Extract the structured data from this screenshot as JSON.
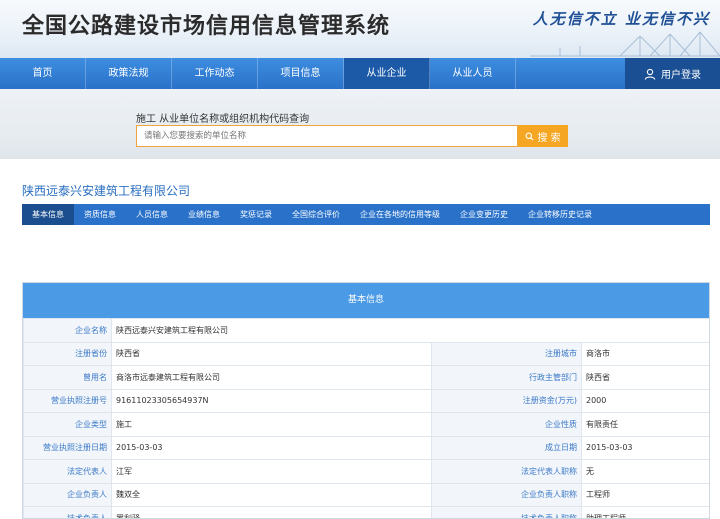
{
  "banner": {
    "title": "全国公路建设市场信用信息管理系统",
    "slogan": "人无信不立 业无信不兴"
  },
  "nav": {
    "items": [
      {
        "label": "首页"
      },
      {
        "label": "政策法规"
      },
      {
        "label": "工作动态"
      },
      {
        "label": "项目信息"
      },
      {
        "label": "从业企业"
      },
      {
        "label": "从业人员"
      }
    ],
    "active_index": 4,
    "login_label": "用户登录"
  },
  "search": {
    "label": "施工 从业单位名称或组织机构代码查询",
    "placeholder": "请输入您要搜索的单位名称",
    "button_label": "搜 索"
  },
  "company": {
    "name": "陕西远泰兴安建筑工程有限公司"
  },
  "tabs": [
    {
      "label": "基本信息"
    },
    {
      "label": "资质信息"
    },
    {
      "label": "人员信息"
    },
    {
      "label": "业绩信息"
    },
    {
      "label": "奖惩记录"
    },
    {
      "label": "全国综合评价"
    },
    {
      "label": "企业在各地的信用等级"
    },
    {
      "label": "企业变更历史"
    },
    {
      "label": "企业转移历史记录"
    }
  ],
  "info": {
    "header": "基本信息",
    "company_name_label": "企业名称",
    "company_name_value": "陕西远泰兴安建筑工程有限公司",
    "rows": [
      {
        "l1": "注册省份",
        "v1": "陕西省",
        "l2": "注册城市",
        "v2": "商洛市"
      },
      {
        "l1": "曾用名",
        "v1": "商洛市远泰建筑工程有限公司",
        "l2": "行政主管部门",
        "v2": "陕西省"
      },
      {
        "l1": "营业执照注册号",
        "v1": "91611023305654937N",
        "l2": "注册资金(万元)",
        "v2": "2000"
      },
      {
        "l1": "企业类型",
        "v1": "施工",
        "l2": "企业性质",
        "v2": "有限责任"
      },
      {
        "l1": "营业执照注册日期",
        "v1": "2015-03-03",
        "l2": "成立日期",
        "v2": "2015-03-03"
      },
      {
        "l1": "法定代表人",
        "v1": "江军",
        "l2": "法定代表人职称",
        "v2": "无"
      },
      {
        "l1": "企业负责人",
        "v1": "魏双全",
        "l2": "企业负责人职称",
        "v2": "工程师"
      },
      {
        "l1": "技术负责人",
        "v1": "罗利驿",
        "l2": "技术负责人职称",
        "v2": "助理工程师"
      }
    ]
  },
  "colors": {
    "nav": "#2a72c9",
    "accent_orange": "#f5a623",
    "link_blue": "#2a6fc0",
    "table_header": "#4a9ae6"
  }
}
